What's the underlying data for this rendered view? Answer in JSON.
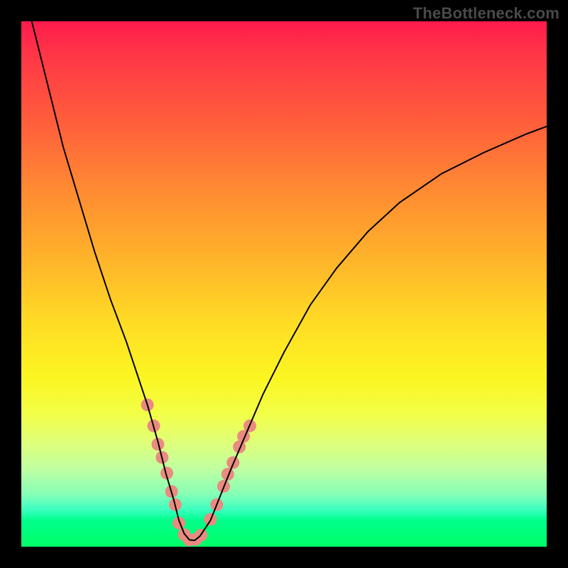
{
  "watermark": "TheBottleneck.com",
  "chart_data": {
    "type": "line",
    "title": "",
    "xlabel": "",
    "ylabel": "",
    "xlim": [
      0,
      100
    ],
    "ylim": [
      0,
      100
    ],
    "grid": false,
    "legend": false,
    "series": [
      {
        "name": "bottleneck-curve",
        "stroke": "#000000",
        "x": [
          2,
          5,
          8,
          11,
          14,
          17,
          20,
          22,
          24,
          26,
          27.5,
          29,
          30,
          31,
          32,
          33,
          34,
          36,
          38,
          40,
          43,
          46,
          50,
          55,
          60,
          66,
          72,
          80,
          88,
          96,
          100
        ],
        "values": [
          100,
          88,
          76,
          66,
          56,
          47,
          39,
          33,
          27,
          20,
          14,
          9,
          5,
          2.5,
          1.3,
          1.2,
          2,
          5,
          10,
          15,
          22,
          29,
          37,
          46,
          53,
          60,
          65.5,
          71,
          75,
          78.5,
          80
        ]
      }
    ],
    "markers": {
      "name": "highlight-dots",
      "color": "#e98b80",
      "radius_px": 9,
      "x": [
        24,
        25.2,
        26,
        26.8,
        27.7,
        28.6,
        29.3,
        30.0,
        31.0,
        32.0,
        33.2,
        34.2,
        36.0,
        37.2,
        38.5,
        39.3,
        40.3,
        41.5,
        42.3,
        43.5
      ],
      "values": [
        27,
        23,
        19.5,
        17,
        14,
        10.5,
        8,
        4.5,
        2.3,
        1.3,
        1.4,
        2.2,
        5.2,
        8,
        11.5,
        13.8,
        16,
        19,
        21,
        23
      ]
    },
    "background_gradient": {
      "top": "#ff1a4d",
      "middle": "#ffde24",
      "bottom": "#00ff66"
    }
  }
}
